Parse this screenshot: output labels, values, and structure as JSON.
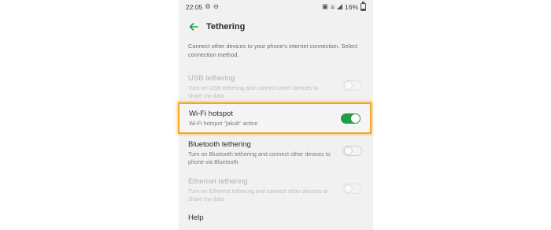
{
  "status_bar": {
    "time": "22:05",
    "battery": "16%"
  },
  "header": {
    "title": "Tethering"
  },
  "description": "Connect other devices to your phone's internet connection. Select connection method.",
  "options": [
    {
      "title": "USB tethering",
      "subtitle": "Turn on USB tethering and connect other devices to share my data",
      "enabled": false,
      "on": false
    },
    {
      "title": "Wi-Fi hotspot",
      "subtitle": "Wi-Fi hotspot \"jakub\" active",
      "enabled": true,
      "on": true
    },
    {
      "title": "Bluetooth tethering",
      "subtitle": "Turn on Bluetooth tethering and connect other devices to phone via Bluetooth",
      "enabled": true,
      "on": false
    },
    {
      "title": "Ethernet tethering",
      "subtitle": "Turn on Ethernet tethering and connect other devices to share my data",
      "enabled": false,
      "on": false
    }
  ],
  "help_label": "Help",
  "colors": {
    "accent": "#1f9d4a",
    "highlight": "#f5a623"
  }
}
